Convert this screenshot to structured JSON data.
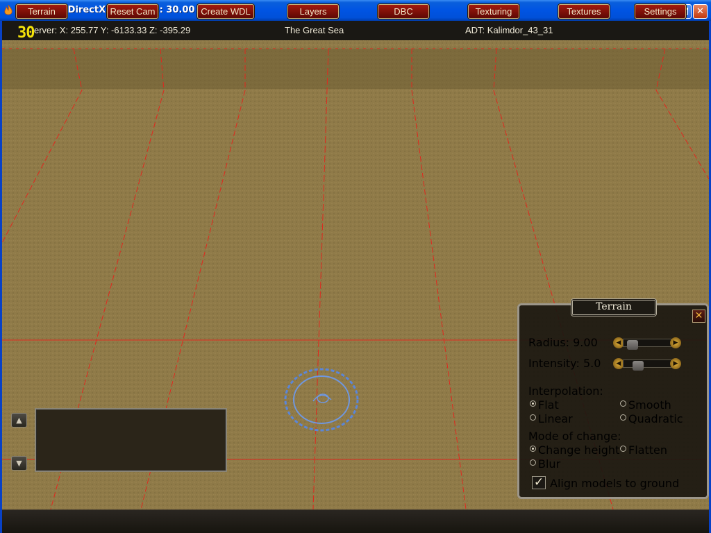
{
  "window": {
    "title": "YiasEdit - DirectX 9.0c - FPS: 30.00",
    "app_icon": "flame-icon",
    "buttons": {
      "minimize": "minimize-icon",
      "maximize": "maximize-icon",
      "close": "✕"
    }
  },
  "statusbar": {
    "fps_overlay": "30",
    "coords": "erver: X: 255.77  Y: -6133.33  Z: -395.29",
    "zone": "The Great Sea",
    "adt": "ADT: Kalimdor_43_31"
  },
  "colors": {
    "grid_line": "#e0281e",
    "terrain": "#8f7a48",
    "brush_ring": "#5b86d8",
    "button_red": "#8a1208",
    "fps_yellow": "#f4e20a"
  },
  "terrain_panel": {
    "title": "Terrain",
    "close_label": "✕",
    "radius_label": "Radius: 9.00",
    "radius_level": 0.1,
    "intensity_label": "Intensity: 5.0",
    "intensity_level": 0.25,
    "interpolation_label": "Interpolation:",
    "interpolation_options": [
      "Flat",
      "Smooth",
      "Linear",
      "Quadratic"
    ],
    "interpolation_selected": "Flat",
    "mode_label": "Mode of change:",
    "mode_options": [
      "Change height",
      "Flatten",
      "Blur"
    ],
    "mode_selected": "Change height",
    "align_label": "Align models to ground",
    "align_checked": true,
    "check_glyph": "✓"
  },
  "chat": {
    "up_icon": "arrow-up-icon",
    "down_icon": "arrow-down-icon",
    "up_glyph": "▲",
    "down_glyph": "▼"
  },
  "toolbar": {
    "buttons": [
      "Terrain",
      "Reset Cam",
      "Create WDL",
      "Layers",
      "DBC",
      "Texturing",
      "Textures",
      "Settings"
    ]
  }
}
